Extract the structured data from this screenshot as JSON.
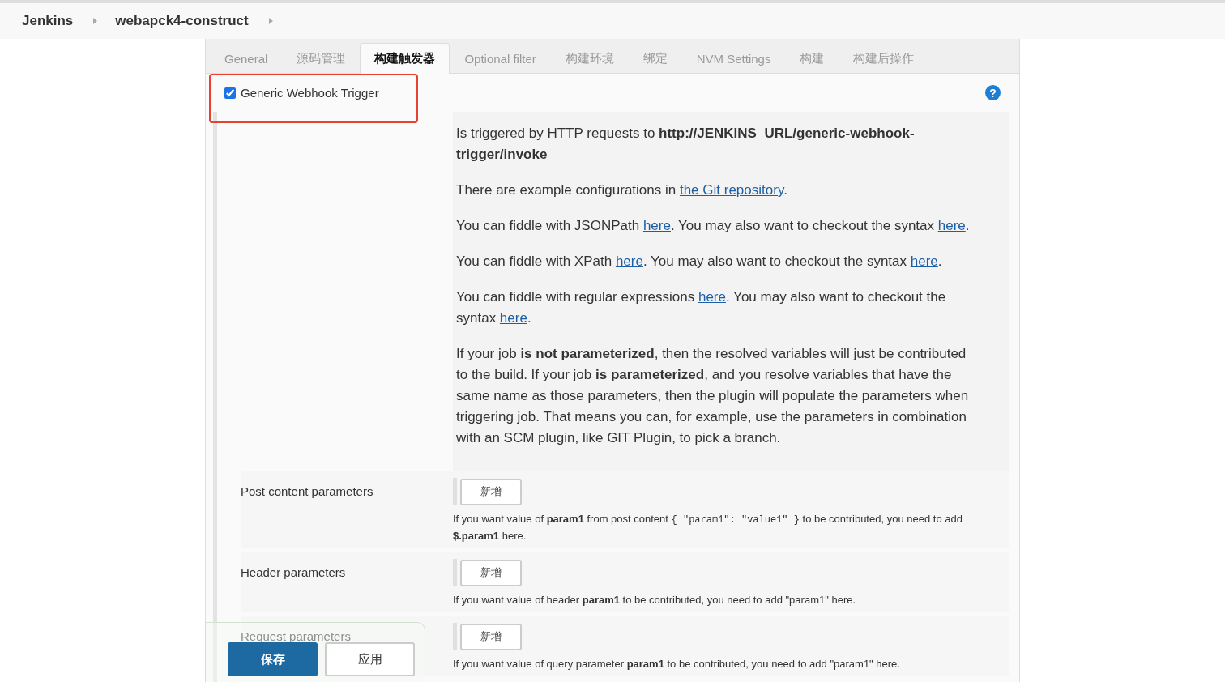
{
  "breadcrumb": [
    {
      "label": "Jenkins"
    },
    {
      "label": "webapck4-construct"
    }
  ],
  "tabs": [
    {
      "label": "General",
      "selected": false
    },
    {
      "label": "源码管理",
      "selected": false
    },
    {
      "label": "构建触发器",
      "selected": true
    },
    {
      "label": "Optional filter",
      "selected": false
    },
    {
      "label": "构建环境",
      "selected": false
    },
    {
      "label": "绑定",
      "selected": false
    },
    {
      "label": "NVM Settings",
      "selected": false
    },
    {
      "label": "构建",
      "selected": false
    },
    {
      "label": "构建后操作",
      "selected": false
    }
  ],
  "trigger": {
    "label": "Generic Webhook Trigger",
    "checked": true,
    "help": "?"
  },
  "help_paragraphs": [
    [
      {
        "kind": "plain",
        "text": "Is triggered by HTTP requests to "
      },
      {
        "kind": "bold",
        "text": "http://JENKINS_URL/generic-webhook-trigger/invoke"
      }
    ],
    [
      {
        "kind": "plain",
        "text": "There are example configurations in "
      },
      {
        "kind": "link",
        "text": "the Git repository"
      },
      {
        "kind": "plain",
        "text": "."
      }
    ],
    [
      {
        "kind": "plain",
        "text": "You can fiddle with JSONPath "
      },
      {
        "kind": "link",
        "text": "here"
      },
      {
        "kind": "plain",
        "text": ". You may also want to checkout the syntax "
      },
      {
        "kind": "link",
        "text": "here"
      },
      {
        "kind": "plain",
        "text": "."
      }
    ],
    [
      {
        "kind": "plain",
        "text": "You can fiddle with XPath "
      },
      {
        "kind": "link",
        "text": "here"
      },
      {
        "kind": "plain",
        "text": ". You may also want to checkout the syntax "
      },
      {
        "kind": "link",
        "text": "here"
      },
      {
        "kind": "plain",
        "text": "."
      }
    ],
    [
      {
        "kind": "plain",
        "text": "You can fiddle with regular expressions "
      },
      {
        "kind": "link",
        "text": "here"
      },
      {
        "kind": "plain",
        "text": ". You may also want to checkout the syntax "
      },
      {
        "kind": "link",
        "text": "here"
      },
      {
        "kind": "plain",
        "text": "."
      }
    ],
    [
      {
        "kind": "plain",
        "text": "If your job "
      },
      {
        "kind": "bold",
        "text": "is not parameterized"
      },
      {
        "kind": "plain",
        "text": ", then the resolved variables will just be contributed to the build. If your job "
      },
      {
        "kind": "bold",
        "text": "is parameterized"
      },
      {
        "kind": "plain",
        "text": ", and you resolve variables that have the same name as those parameters, then the plugin will populate the parameters when triggering job. That means you can, for example, use the parameters in combination with an SCM plugin, like GIT Plugin, to pick a branch."
      }
    ]
  ],
  "parameter_sections": [
    {
      "label": "Post content parameters",
      "button": "新增",
      "description": [
        {
          "kind": "plain",
          "text": "If you want value of "
        },
        {
          "kind": "bold",
          "text": "param1"
        },
        {
          "kind": "plain",
          "text": " from post content "
        },
        {
          "kind": "code",
          "text": "{ \"param1\": \"value1\" }"
        },
        {
          "kind": "plain",
          "text": " to be contributed, you need to add "
        },
        {
          "kind": "bold",
          "text": "$.param1"
        },
        {
          "kind": "plain",
          "text": " here."
        }
      ]
    },
    {
      "label": "Header parameters",
      "button": "新增",
      "description": [
        {
          "kind": "plain",
          "text": "If you want value of header "
        },
        {
          "kind": "bold",
          "text": "param1"
        },
        {
          "kind": "plain",
          "text": " to be contributed, you need to add \"param1\" here."
        }
      ]
    },
    {
      "label": "Request parameters",
      "button": "新增",
      "description": [
        {
          "kind": "plain",
          "text": "If you want value of query parameter "
        },
        {
          "kind": "bold",
          "text": "param1"
        },
        {
          "kind": "plain",
          "text": " to be contributed, you need to add \"param1\" here."
        }
      ]
    }
  ],
  "footer_buttons": [
    {
      "label": "保存",
      "kind": "primary"
    },
    {
      "label": "应用",
      "kind": "secondary"
    }
  ]
}
